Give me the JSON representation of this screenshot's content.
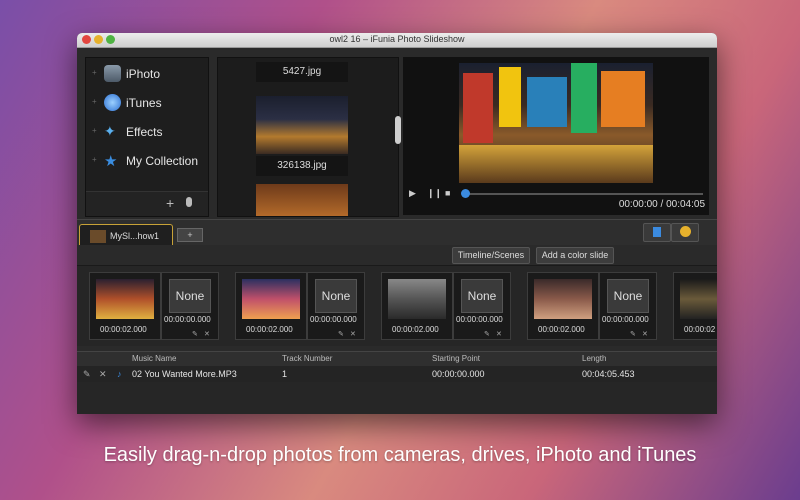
{
  "window": {
    "title": "owl2 16 – iFunia Photo Slideshow"
  },
  "sidebar": {
    "items": [
      {
        "label": "iPhoto",
        "icon": "iphoto-icon",
        "color": "#6c7a8a"
      },
      {
        "label": "iTunes",
        "icon": "itunes-icon",
        "color": "#3b7fd8"
      },
      {
        "label": "Effects",
        "icon": "magic-wand-icon",
        "color": "#4aa3e0"
      },
      {
        "label": "My Collection",
        "icon": "star-icon",
        "color": "#3a8de0"
      }
    ]
  },
  "photos": [
    {
      "name": "5427.jpg"
    },
    {
      "name": "326138.jpg"
    }
  ],
  "preview": {
    "timecode": "00:00:00 / 00:04:05"
  },
  "tabs": [
    {
      "label": "MySl...how1"
    }
  ],
  "toolbar": {
    "timeline_label": "Timeline/Scenes",
    "color_slide_label": "Add a color slide"
  },
  "slides": [
    {
      "duration": "00:00:02.000",
      "transition": "None",
      "transition_duration": "00:00:00.000"
    },
    {
      "duration": "00:00:02.000",
      "transition": "None",
      "transition_duration": "00:00:00.000"
    },
    {
      "duration": "00:00:02.000",
      "transition": "None",
      "transition_duration": "00:00:00.000"
    },
    {
      "duration": "00:00:02.000",
      "transition": "None",
      "transition_duration": "00:00:00.000"
    },
    {
      "duration": "00:00:02"
    }
  ],
  "music": {
    "columns": [
      "Music Name",
      "Track Number",
      "Starting Point",
      "Length"
    ],
    "rows": [
      {
        "name": "02 You Wanted More.MP3",
        "track": "1",
        "start": "00:00:00.000",
        "length": "00:04:05.453"
      }
    ]
  },
  "caption": "Easily drag-n-drop photos from cameras, drives, iPhoto and iTunes"
}
